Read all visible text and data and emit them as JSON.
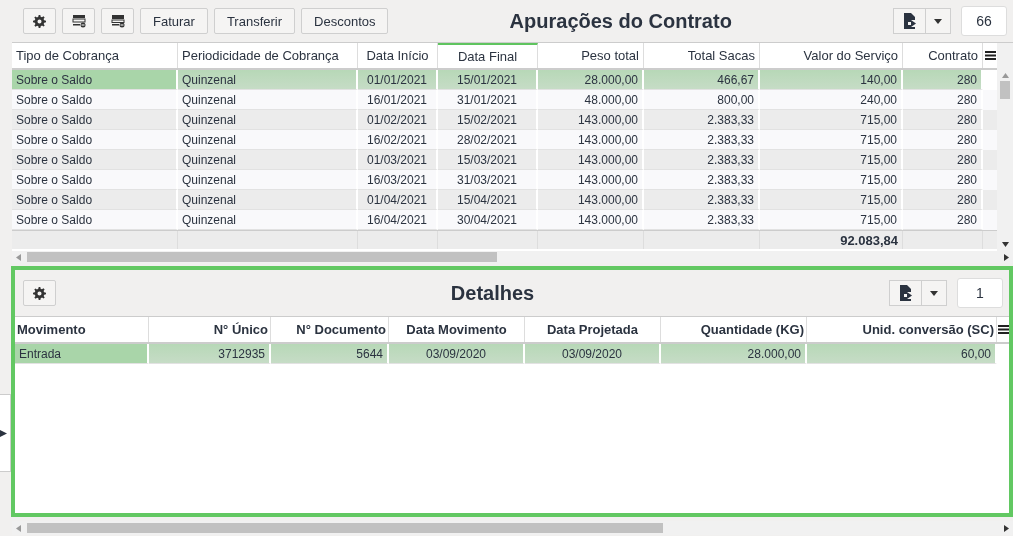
{
  "top": {
    "title": "Apurações do Contrato",
    "buttons": [
      "Faturar",
      "Transferir",
      "Descontos"
    ],
    "count": "66",
    "table": {
      "columns": [
        {
          "label": "Tipo de Cobrança",
          "kind": "text",
          "sorted": false
        },
        {
          "label": "Periodicidade de Cobrança",
          "kind": "text",
          "sorted": false
        },
        {
          "label": "Data Início",
          "kind": "date",
          "sorted": false
        },
        {
          "label": "Data Final",
          "kind": "date",
          "sorted": true
        },
        {
          "label": "Peso total",
          "kind": "number",
          "sorted": false
        },
        {
          "label": "Total Sacas",
          "kind": "number",
          "sorted": false
        },
        {
          "label": "Valor do Serviço",
          "kind": "number",
          "sorted": false,
          "total": "92.083,84"
        },
        {
          "label": "Contrato",
          "kind": "number",
          "sorted": false
        }
      ],
      "rows": [
        {
          "selected": true,
          "cells": [
            "Sobre o Saldo",
            "Quinzenal",
            "01/01/2021",
            "15/01/2021",
            "28.000,00",
            "466,67",
            "140,00",
            "280"
          ]
        },
        {
          "selected": false,
          "cells": [
            "Sobre o Saldo",
            "Quinzenal",
            "16/01/2021",
            "31/01/2021",
            "48.000,00",
            "800,00",
            "240,00",
            "280"
          ]
        },
        {
          "selected": false,
          "cells": [
            "Sobre o Saldo",
            "Quinzenal",
            "01/02/2021",
            "15/02/2021",
            "143.000,00",
            "2.383,33",
            "715,00",
            "280"
          ]
        },
        {
          "selected": false,
          "cells": [
            "Sobre o Saldo",
            "Quinzenal",
            "16/02/2021",
            "28/02/2021",
            "143.000,00",
            "2.383,33",
            "715,00",
            "280"
          ]
        },
        {
          "selected": false,
          "cells": [
            "Sobre o Saldo",
            "Quinzenal",
            "01/03/2021",
            "15/03/2021",
            "143.000,00",
            "2.383,33",
            "715,00",
            "280"
          ]
        },
        {
          "selected": false,
          "cells": [
            "Sobre o Saldo",
            "Quinzenal",
            "16/03/2021",
            "31/03/2021",
            "143.000,00",
            "2.383,33",
            "715,00",
            "280"
          ]
        },
        {
          "selected": false,
          "cells": [
            "Sobre o Saldo",
            "Quinzenal",
            "01/04/2021",
            "15/04/2021",
            "143.000,00",
            "2.383,33",
            "715,00",
            "280"
          ]
        },
        {
          "selected": false,
          "cells": [
            "Sobre o Saldo",
            "Quinzenal",
            "16/04/2021",
            "30/04/2021",
            "143.000,00",
            "2.383,33",
            "715,00",
            "280"
          ]
        }
      ]
    }
  },
  "details": {
    "title": "Detalhes",
    "count": "1",
    "table": {
      "columns": [
        {
          "label": "Movimento",
          "kind": "text",
          "sorted": false
        },
        {
          "label": "N° Único",
          "kind": "number",
          "sorted": false
        },
        {
          "label": "N° Documento",
          "kind": "number",
          "sorted": false
        },
        {
          "label": "Data Movimento",
          "kind": "date",
          "sorted": false
        },
        {
          "label": "Data Projetada",
          "kind": "date",
          "sorted": false
        },
        {
          "label": "Quantidade (KG)",
          "kind": "number",
          "sorted": false
        },
        {
          "label": "Unid. conversão (SC)",
          "kind": "number",
          "sorted": false
        }
      ],
      "rows": [
        {
          "selected": true,
          "cells": [
            "Entrada",
            "3712935",
            "5644",
            "03/09/2020",
            "03/09/2020",
            "28.000,00",
            "60,00"
          ]
        }
      ]
    }
  }
}
